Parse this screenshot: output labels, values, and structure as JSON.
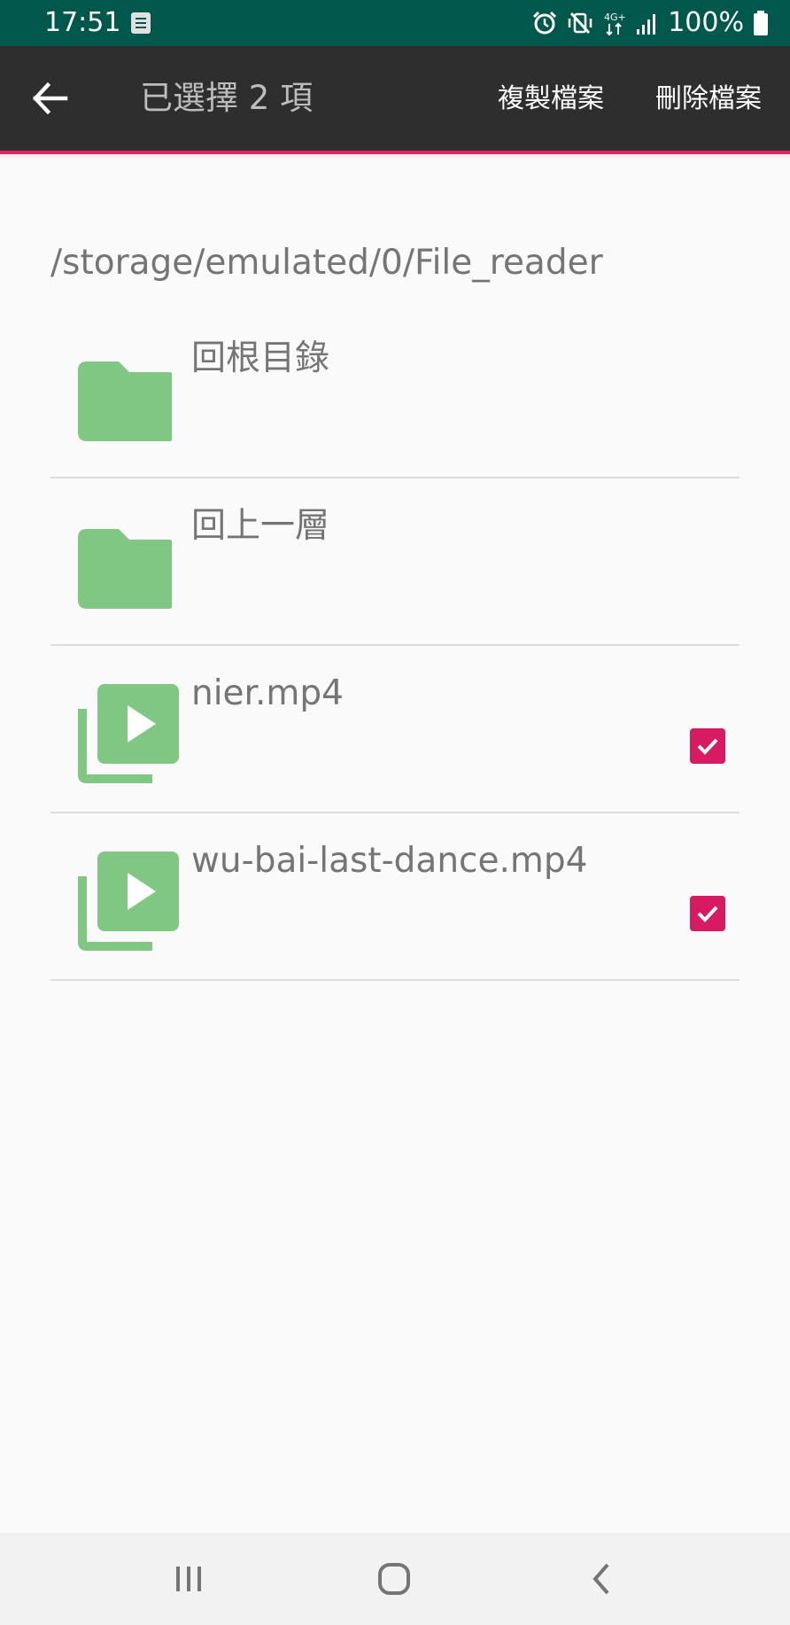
{
  "status_bar": {
    "time": "17:51",
    "battery": "100%",
    "icons": [
      "notification-icon",
      "alarm-icon",
      "vibrate-off-icon",
      "4g-icon",
      "signal-icon",
      "battery-icon"
    ]
  },
  "app_bar": {
    "title": "已選擇 2 項",
    "actions": {
      "copy": "複製檔案",
      "delete": "刪除檔案"
    }
  },
  "path": "/storage/emulated/0/File_reader",
  "files": [
    {
      "name": "回根目錄",
      "icon": "folder-icon",
      "checked": false
    },
    {
      "name": "回上一層",
      "icon": "folder-icon",
      "checked": false
    },
    {
      "name": "nier.mp4",
      "icon": "video-library-icon",
      "checked": true
    },
    {
      "name": "wu-bai-last-dance.mp4",
      "icon": "video-library-icon",
      "checked": true
    }
  ],
  "colors": {
    "status_bar": "#00574b",
    "app_bar": "#2e2e2e",
    "accent": "#e91e63",
    "icon_green": "#81c784",
    "checkbox": "#d81b60"
  }
}
